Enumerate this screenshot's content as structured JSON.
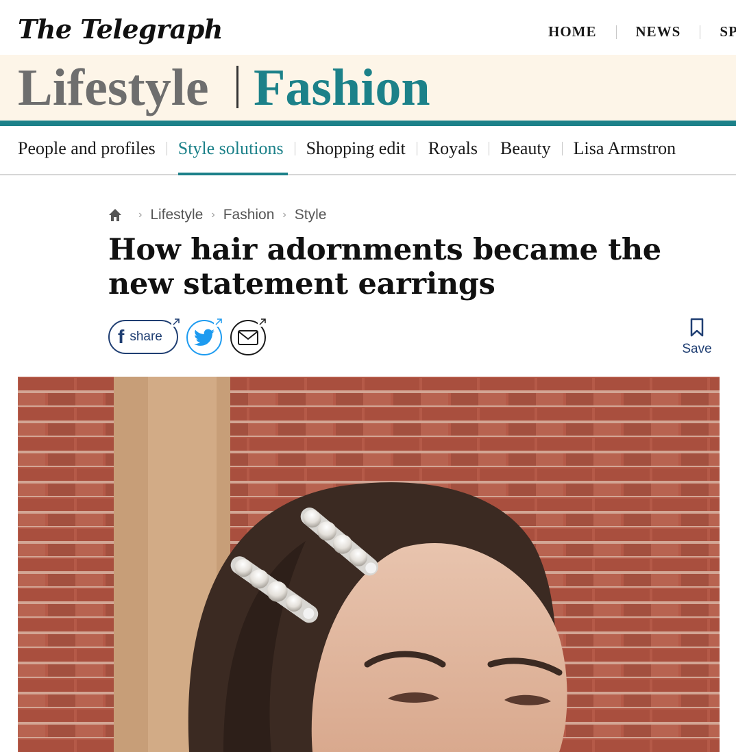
{
  "header": {
    "logo_text": "The Telegraph",
    "nav": [
      "HOME",
      "NEWS",
      "SP"
    ]
  },
  "section": {
    "parent": "Lifestyle",
    "name": "Fashion",
    "accent_color": "#1c8189",
    "banner_bg": "#fdf5e8"
  },
  "subnav": {
    "items": [
      "People and profiles",
      "Style solutions",
      "Shopping edit",
      "Royals",
      "Beauty",
      "Lisa Armstron"
    ],
    "active_index": 1
  },
  "breadcrumb": {
    "home_icon": "home-icon",
    "items": [
      "Lifestyle",
      "Fashion",
      "Style"
    ]
  },
  "article": {
    "headline": "How hair adornments became the new statement earrings"
  },
  "share": {
    "facebook_label": "share",
    "twitter_icon": "twitter-icon",
    "email_icon": "email-icon"
  },
  "save": {
    "label": "Save",
    "icon": "bookmark-icon"
  },
  "hero_image": {
    "subject": "photo"
  }
}
